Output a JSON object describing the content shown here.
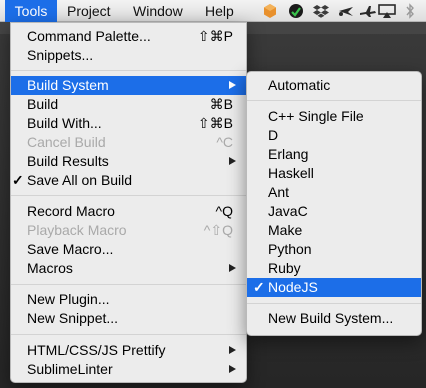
{
  "menubar": {
    "tools": "Tools",
    "project": "Project",
    "window": "Window",
    "help": "Help"
  },
  "tray": [
    "sublime-icon",
    "globe-icon",
    "dropbox-icon",
    "scissors-icon",
    "plane-icon",
    "airplay-icon",
    "bluetooth-icon"
  ],
  "tools_menu": {
    "command_palette": {
      "label": "Command Palette...",
      "shortcut": "⇧⌘P"
    },
    "snippets": {
      "label": "Snippets..."
    },
    "build_system": {
      "label": "Build System"
    },
    "build": {
      "label": "Build",
      "shortcut": "⌘B"
    },
    "build_with": {
      "label": "Build With...",
      "shortcut": "⇧⌘B"
    },
    "cancel_build": {
      "label": "Cancel Build",
      "shortcut": "^C"
    },
    "build_results": {
      "label": "Build Results"
    },
    "save_all_on_build": {
      "label": "Save All on Build",
      "check": "✓"
    },
    "record_macro": {
      "label": "Record Macro",
      "shortcut": "^Q"
    },
    "playback_macro": {
      "label": "Playback Macro",
      "shortcut": "^⇧Q"
    },
    "save_macro": {
      "label": "Save Macro..."
    },
    "macros": {
      "label": "Macros"
    },
    "new_plugin": {
      "label": "New Plugin..."
    },
    "new_snippet": {
      "label": "New Snippet..."
    },
    "html_prettify": {
      "label": "HTML/CSS/JS Prettify"
    },
    "sublimelinter": {
      "label": "SublimeLinter"
    }
  },
  "build_system_menu": {
    "automatic": "Automatic",
    "items": [
      "C++ Single File",
      "D",
      "Erlang",
      "Haskell",
      "Ant",
      "JavaC",
      "Make",
      "Python",
      "Ruby"
    ],
    "nodejs": "NodeJS",
    "nodejs_check": "✓",
    "new_build_system": "New Build System..."
  },
  "colors": {
    "highlight": "#1c6ee8",
    "menu_bg": "#ececec"
  }
}
